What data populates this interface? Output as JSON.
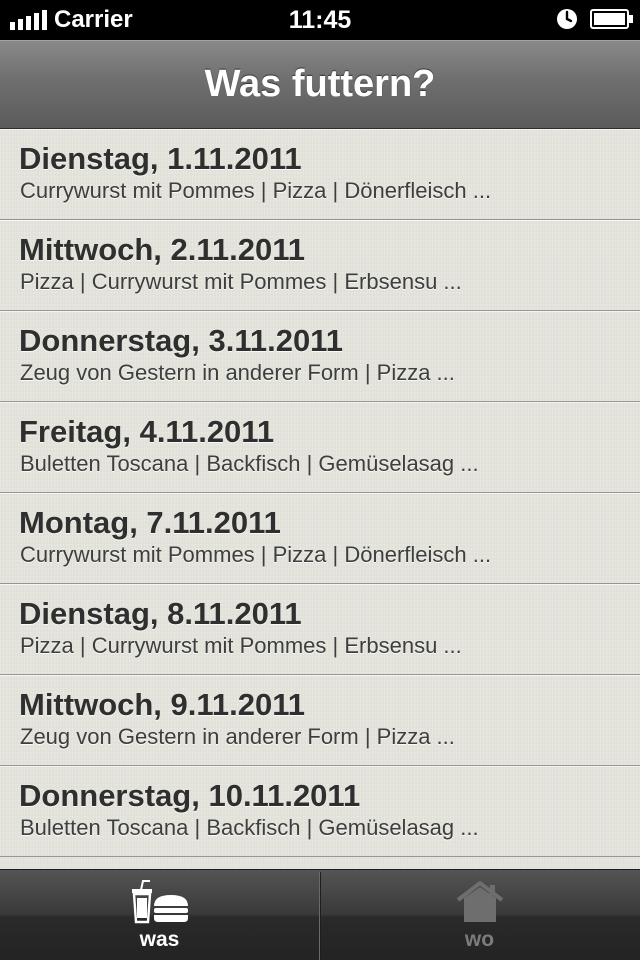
{
  "status_bar": {
    "carrier": "Carrier",
    "time": "11:45",
    "icons": [
      "signal-icon",
      "clock-icon",
      "battery-icon"
    ]
  },
  "nav": {
    "title": "Was futtern?"
  },
  "days": [
    {
      "title": "Dienstag, 1.11.2011",
      "subtitle": "Currywurst mit Pommes | Pizza | Dönerfleisch ..."
    },
    {
      "title": "Mittwoch, 2.11.2011",
      "subtitle": "Pizza | Currywurst mit Pommes | Erbsensu ..."
    },
    {
      "title": "Donnerstag, 3.11.2011",
      "subtitle": "Zeug von Gestern in anderer Form | Pizza ..."
    },
    {
      "title": "Freitag, 4.11.2011",
      "subtitle": "Buletten Toscana | Backfisch | Gemüselasag ..."
    },
    {
      "title": "Montag, 7.11.2011",
      "subtitle": "Currywurst mit Pommes | Pizza | Dönerfleisch ..."
    },
    {
      "title": "Dienstag, 8.11.2011",
      "subtitle": "Pizza | Currywurst mit Pommes | Erbsensu ..."
    },
    {
      "title": "Mittwoch, 9.11.2011",
      "subtitle": "Zeug von Gestern in anderer Form | Pizza ..."
    },
    {
      "title": "Donnerstag, 10.11.2011",
      "subtitle": "Buletten Toscana | Backfisch | Gemüselasag ..."
    }
  ],
  "tabs": [
    {
      "label": "was",
      "icon": "drink-burger-icon",
      "selected": true
    },
    {
      "label": "wo",
      "icon": "house-icon",
      "selected": false
    }
  ],
  "colors": {
    "list_background": "#e5e5dd",
    "row_separator": "#979791",
    "tab_selected": "#ffffff",
    "tab_unselected": "#7c7c7c"
  }
}
